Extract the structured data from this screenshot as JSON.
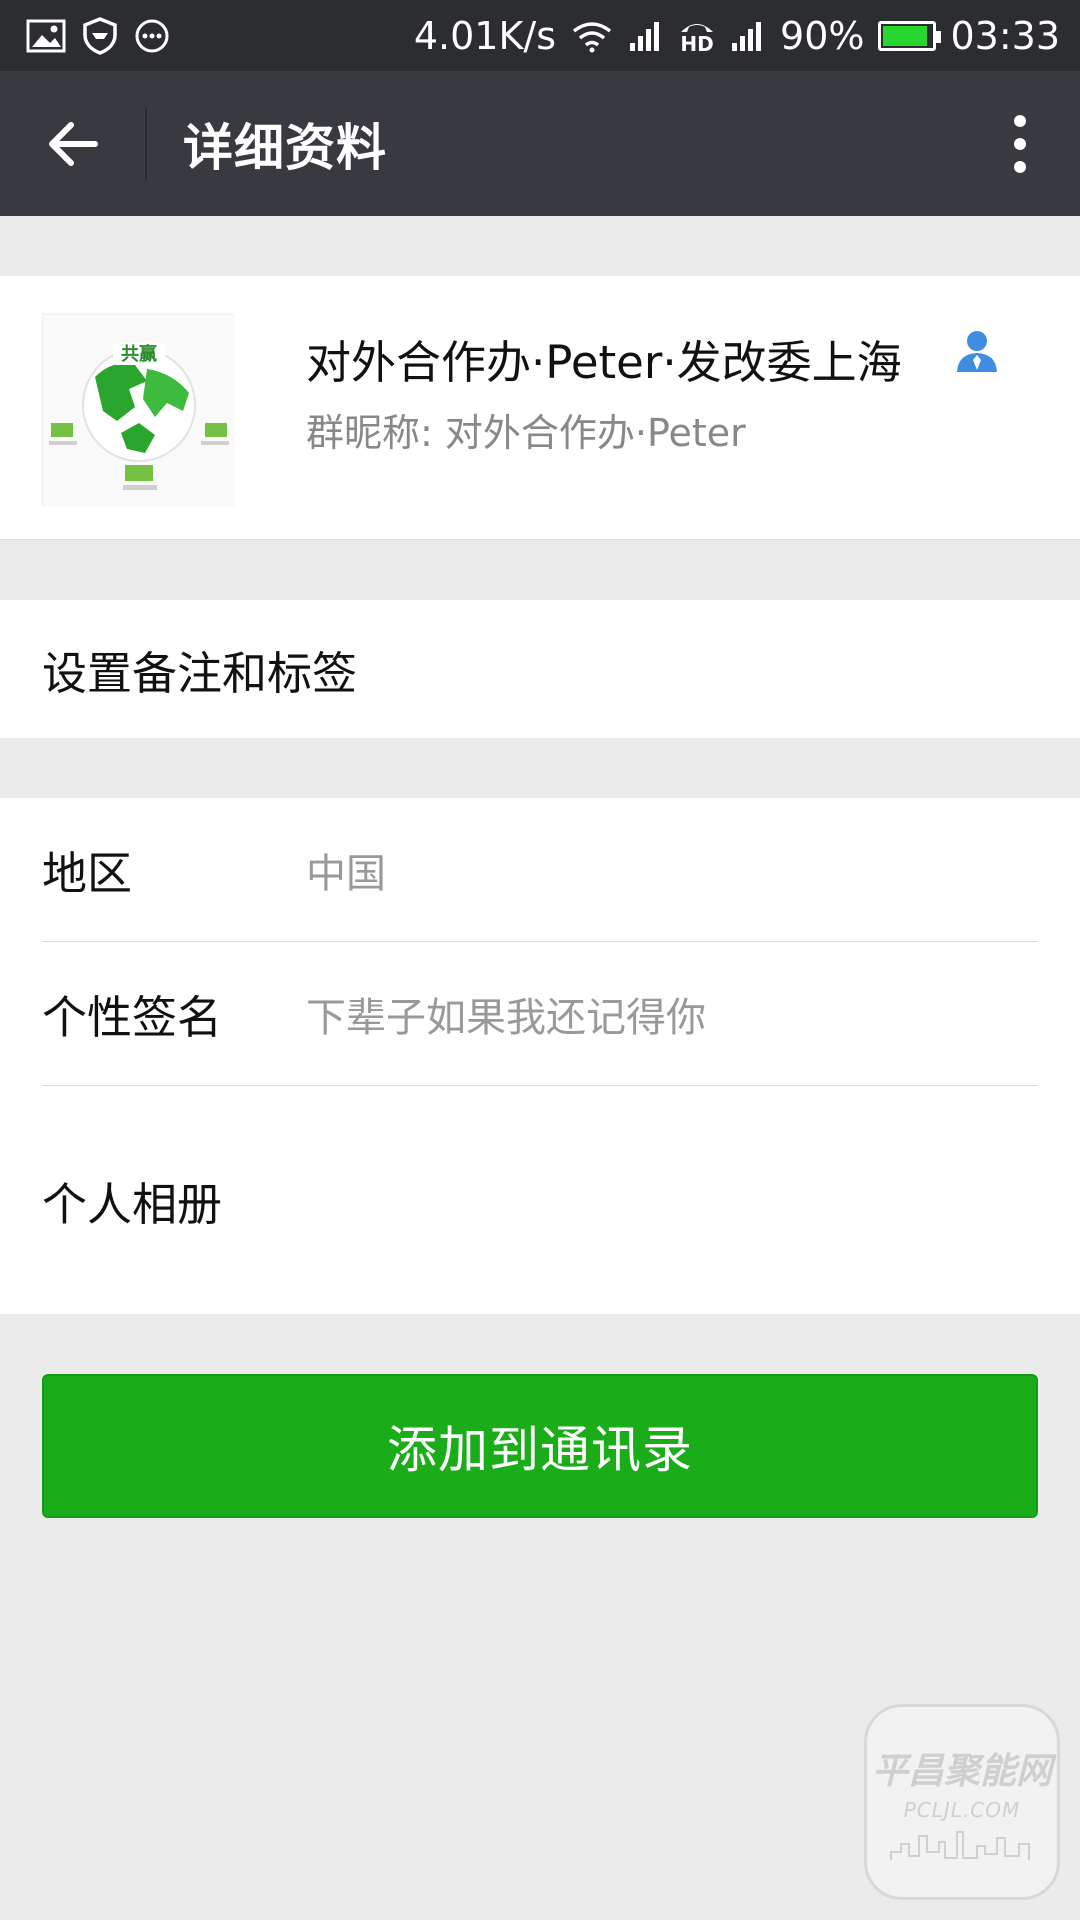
{
  "status_bar": {
    "speed": "4.01K/s",
    "hd_label": "HD",
    "battery": "90%",
    "battery_level": 0.9,
    "time": "03:33",
    "icons": [
      "image-icon",
      "shield-icon",
      "chat-bubble-icon",
      "wifi-icon",
      "signal-icon",
      "call-icon",
      "signal-icon",
      "battery-icon"
    ]
  },
  "header": {
    "title": "详细资料"
  },
  "profile": {
    "name": "对外合作办·Peter·发改委上海",
    "group_nickname": "群昵称: 对外合作办·Peter",
    "avatar_caption": "共赢"
  },
  "remarks": {
    "label": "设置备注和标签"
  },
  "info": {
    "region_label": "地区",
    "region_value": "中国",
    "signature_label": "个性签名",
    "signature_value": "下辈子如果我还记得你",
    "album_label": "个人相册"
  },
  "actions": {
    "add_contact": "添加到通讯录"
  },
  "watermark": {
    "main": "平昌聚能网",
    "sub": "PCLJL.COM"
  },
  "colors": {
    "status_bar_bg": "#2b2d30",
    "title_bar_bg": "#393a3f",
    "page_bg": "#ebebeb",
    "primary_green": "#1aad19",
    "contact_icon_blue": "#3f8de0"
  }
}
